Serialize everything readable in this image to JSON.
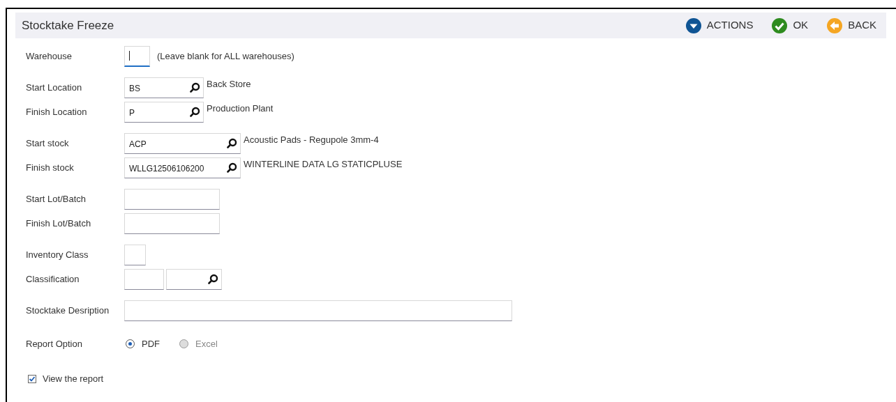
{
  "header": {
    "title": "Stocktake Freeze",
    "actions": [
      {
        "label": "ACTIONS",
        "kind": "actions"
      },
      {
        "label": "OK",
        "kind": "ok"
      },
      {
        "label": "BACK",
        "kind": "back"
      }
    ]
  },
  "groups": [
    [
      {
        "kind": "text",
        "label": "Warehouse",
        "focused": true,
        "note": "(Leave blank for ALL warehouses)"
      }
    ],
    [
      {
        "kind": "lookup",
        "label": "Start Location",
        "value": "BS",
        "note": "Back Store"
      },
      {
        "kind": "lookup",
        "label": "Finish Location",
        "value": "P",
        "note": "Production Plant"
      }
    ],
    [
      {
        "kind": "lookup",
        "label": "Start stock",
        "value": "ACP",
        "note": "Acoustic Pads - Regupole 3mm-4"
      },
      {
        "kind": "lookup",
        "label": "Finish stock",
        "value": "WLLG12506106200",
        "note": "WINTERLINE DATA LG STATICPLUSE"
      }
    ],
    [
      {
        "kind": "text",
        "label": "Start Lot/Batch",
        "focused": false
      },
      {
        "kind": "text",
        "label": "Finish Lot/Batch",
        "focused": false
      }
    ],
    [
      {
        "kind": "text",
        "label": "Inventory Class",
        "focused": false
      },
      {
        "kind": "pair",
        "label": "Classification"
      }
    ],
    [
      {
        "kind": "text",
        "label": "Stocktake Desription",
        "focused": false
      }
    ],
    [
      {
        "kind": "radio",
        "label": "Report Option",
        "options": [
          {
            "label": "PDF",
            "selected": true
          },
          {
            "label": "Excel",
            "selected": false
          }
        ]
      }
    ],
    [
      {
        "kind": "checkbox",
        "label": "View the report",
        "checked": true
      }
    ]
  ]
}
